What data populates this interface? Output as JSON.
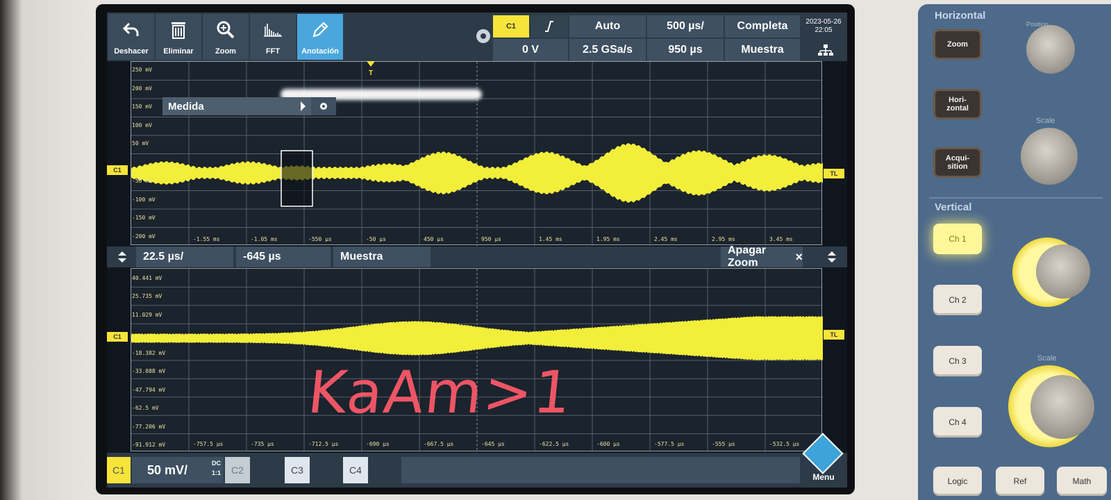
{
  "toolbar": {
    "buttons": [
      {
        "label": "Deshacer",
        "icon": "undo-icon"
      },
      {
        "label": "Eliminar",
        "icon": "trash-icon"
      },
      {
        "label": "Zoom",
        "icon": "zoom-icon"
      },
      {
        "label": "FFT",
        "icon": "fft-icon"
      },
      {
        "label": "Anotación",
        "icon": "pencil-icon",
        "active": true
      }
    ],
    "trigger": {
      "source": "C1",
      "level": "0 V",
      "mode": "Auto",
      "sample_rate": "2.5 GSa/s",
      "timebase": "500 µs/",
      "position": "950 µs",
      "acquisition": "Completa",
      "sampling": "Muestra"
    },
    "date": "2023-05-26",
    "time": "22:05"
  },
  "top_plot": {
    "y_labels": [
      "250 mV",
      "200 mV",
      "150 mV",
      "100 mV",
      "50 mV",
      "-50 mV",
      "-100 mV",
      "-150 mV",
      "-200 mV"
    ],
    "x_labels": [
      "-1.55 ms",
      "-1.05 ms",
      "-550 µs",
      "-50 µs",
      "450 µs",
      "950 µs",
      "1.45 ms",
      "1.95 ms",
      "2.45 ms",
      "2.95 ms",
      "3.45 ms"
    ],
    "channel_tag": "C1",
    "trigger_tag": "TL",
    "trigger_marker": "T"
  },
  "measure_panel": {
    "label": "Medida"
  },
  "zoom_bar": {
    "scale": "22.5 µs/",
    "position": "-645 µs",
    "mode": "Muestra",
    "off_label": "Apagar Zoom",
    "close": "×"
  },
  "bottom_plot": {
    "y_labels": [
      "40.441 mV",
      "25.735 mV",
      "11.029 mV",
      "-18.382 mV",
      "-33.088 mV",
      "-47.794 mV",
      "-62.5 mV",
      "-77.206 mV",
      "-91.912 mV"
    ],
    "x_labels": [
      "-757.5 µs",
      "-735 µs",
      "-712.5 µs",
      "-690 µs",
      "-667.5 µs",
      "-645 µs",
      "-622.5 µs",
      "-600 µs",
      "-577.5 µs",
      "-555 µs",
      "-532.5 µs"
    ],
    "channel_tag": "C1",
    "trigger_tag": "TL"
  },
  "annotation_text": "K<sub>a</sub>Am>1",
  "annotation_display": "KaAm>1",
  "channel_bar": {
    "c1": "C1",
    "c1_scale": "50 mV/",
    "coupling": "DC",
    "ratio": "1:1",
    "c2": "C2",
    "c3": "C3",
    "c4": "C4",
    "menu": "Menu"
  },
  "panel": {
    "horizontal_title": "Horizontal",
    "vertical_title": "Vertical",
    "zoom": "Zoom",
    "horizontal": "Hori-\nzontal",
    "acquisition": "Acqui-\nsition",
    "position": "Position",
    "scale": "Scale",
    "ch1": "Ch 1",
    "ch2": "Ch 2",
    "ch3": "Ch 3",
    "ch4": "Ch 4",
    "logic": "Logic",
    "ref": "Ref",
    "math": "Math"
  },
  "colors": {
    "trace": "#f2ee3a",
    "accent": "#4aa6dc",
    "annotation": "#ff5a6a"
  }
}
